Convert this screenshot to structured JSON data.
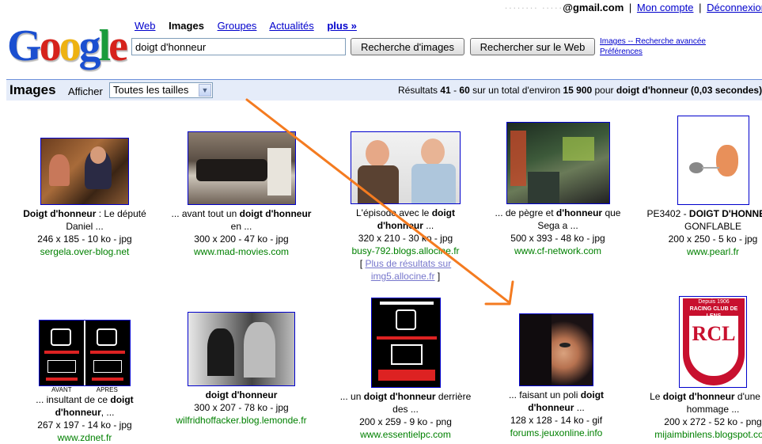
{
  "user": {
    "email_blur": "········ ·····",
    "email_domain": "@gmail.com",
    "account": "Mon compte",
    "logout": "Déconnexion"
  },
  "logo": {
    "letters": [
      "G",
      "o",
      "o",
      "g",
      "l",
      "e"
    ]
  },
  "nav": {
    "web": "Web",
    "images": "Images",
    "groups": "Groupes",
    "news": "Actualités",
    "more": "plus »"
  },
  "search": {
    "query": "doigt d'honneur",
    "btn_images": "Recherche d'images",
    "btn_web": "Rechercher sur le Web",
    "advanced": "Images -- Recherche avancée",
    "prefs": "Préférences"
  },
  "results_bar": {
    "title": "Images",
    "show": "Afficher",
    "size_select": "Toutes les tailles",
    "stats_prefix": "Résultats",
    "from": "41",
    "dash": " - ",
    "to": "60",
    "total_text": " sur un total d'environ ",
    "total": "15 900",
    "for_text": " pour ",
    "query": "doigt d'honneur",
    "time": " (0,03 secondes)"
  },
  "row1": [
    {
      "cap_b": "Doigt d'honneur",
      "cap_rest": " : Le député",
      "line2": "Daniel ...",
      "meta": "246 x 185 - 10 ko - jpg",
      "url": "sergela.over-blog.net"
    },
    {
      "cap_pre": "... avant tout un ",
      "cap_b": "doigt d'honneur",
      "line2": "en ...",
      "meta": "300 x 200 - 47 ko - jpg",
      "url": "www.mad-movies.com"
    },
    {
      "cap_pre": "L'épisode avec le ",
      "cap_b": "doigt",
      "line2b": "d'honneur",
      "line2": " ...",
      "meta": "320 x 210 - 30 ko - jpg",
      "url": "busy-792.blogs.allocine.fr",
      "more_link": "Plus de résultats sur",
      "more_host": "img5.allocine.fr"
    },
    {
      "cap_pre": "... de pègre et ",
      "cap_b": "d'honneur",
      "cap_rest": " que",
      "line2": "Sega a ...",
      "meta": "500 x 393 - 48 ko - jpg",
      "url": "www.cf-network.com"
    },
    {
      "cap_pre": "PE3402 - ",
      "cap_b": "DOIGT D'HONNEUR",
      "line2": "GONFLABLE",
      "meta": "200 x 250 - 5 ko - jpg",
      "url": "www.pearl.fr"
    }
  ],
  "row2": [
    {
      "cap_pre": "... insultant de ce ",
      "cap_b": "doigt",
      "line2b": "d'honneur",
      "line2": ", ...",
      "meta": "267 x 197 - 14 ko - jpg",
      "url": "www.zdnet.fr",
      "img_labels": [
        "AVANT",
        "APRES"
      ]
    },
    {
      "cap_b": "doigt d'honneur",
      "meta": "300 x 207 - 78 ko - jpg",
      "url": "wilfridhoffacker.blog.lemonde.fr"
    },
    {
      "cap_pre": "... un ",
      "cap_b": "doigt d'honneur",
      "cap_rest": " derrière",
      "line2": "des ...",
      "meta": "200 x 259 - 9 ko - png",
      "url": "www.essentielpc.com"
    },
    {
      "cap_pre": "... faisant un poli ",
      "cap_b": "doigt",
      "line2b": "d'honneur",
      "line2": " ...",
      "meta": "128 x 128 - 14 ko - gif",
      "url": "forums.jeuxonline.info"
    },
    {
      "cap_pre": "Le ",
      "cap_b": "doigt d'honneur",
      "cap_rest": " d'une ruc",
      "line2": "hommage ...",
      "meta": "200 x 272 - 52 ko - png",
      "url": "mijaimbinlens.blogspot.com",
      "img_labels": [
        "Depuis 1906",
        "RACING CLUB DE LENS",
        "RCL"
      ]
    }
  ],
  "colors": {
    "link": "#0000cc",
    "url": "#008000",
    "bar": "#e5ecf9",
    "arrow": "#f47b20"
  }
}
